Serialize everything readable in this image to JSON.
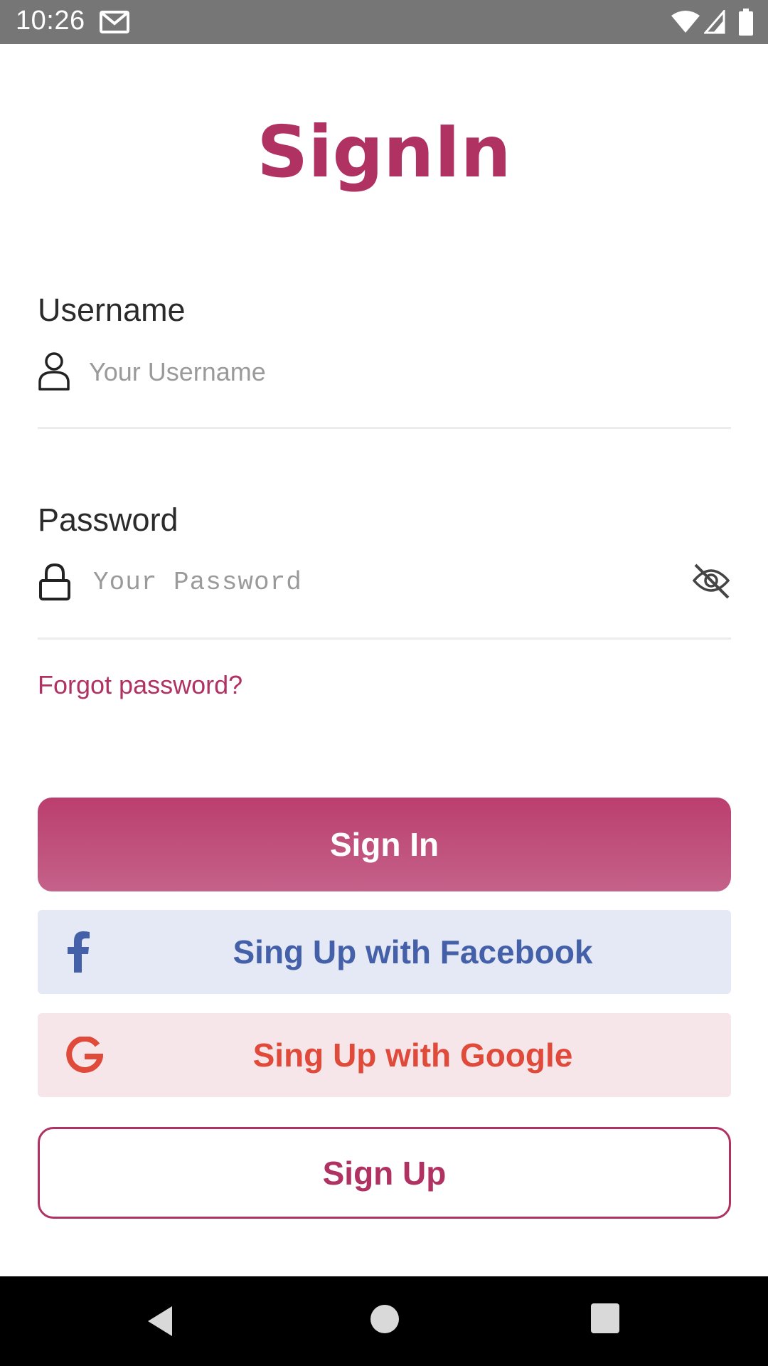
{
  "status_bar": {
    "time": "10:26",
    "icons": [
      "gmail-icon",
      "wifi-icon",
      "cell-signal-icon",
      "battery-icon"
    ]
  },
  "title": "SignIn",
  "username": {
    "label": "Username",
    "placeholder": "Your Username",
    "value": "",
    "icon": "user-icon"
  },
  "password": {
    "label": "Password",
    "placeholder": "Your Password",
    "value": "",
    "icon": "lock-icon",
    "toggle_icon": "eye-off-icon"
  },
  "forgot_password": "Forgot password?",
  "buttons": {
    "sign_in": "Sign In",
    "facebook": "Sing Up with Facebook",
    "google": "Sing Up with Google",
    "sign_up": "Sign Up"
  },
  "colors": {
    "brand": "#b03262",
    "facebook": "#4460a8",
    "facebook_bg": "#e5e9f5",
    "google": "#df4a3a",
    "google_bg": "#f6e5e9"
  },
  "nav_bar": {
    "icons": [
      "back-icon",
      "home-icon",
      "recents-icon"
    ]
  }
}
